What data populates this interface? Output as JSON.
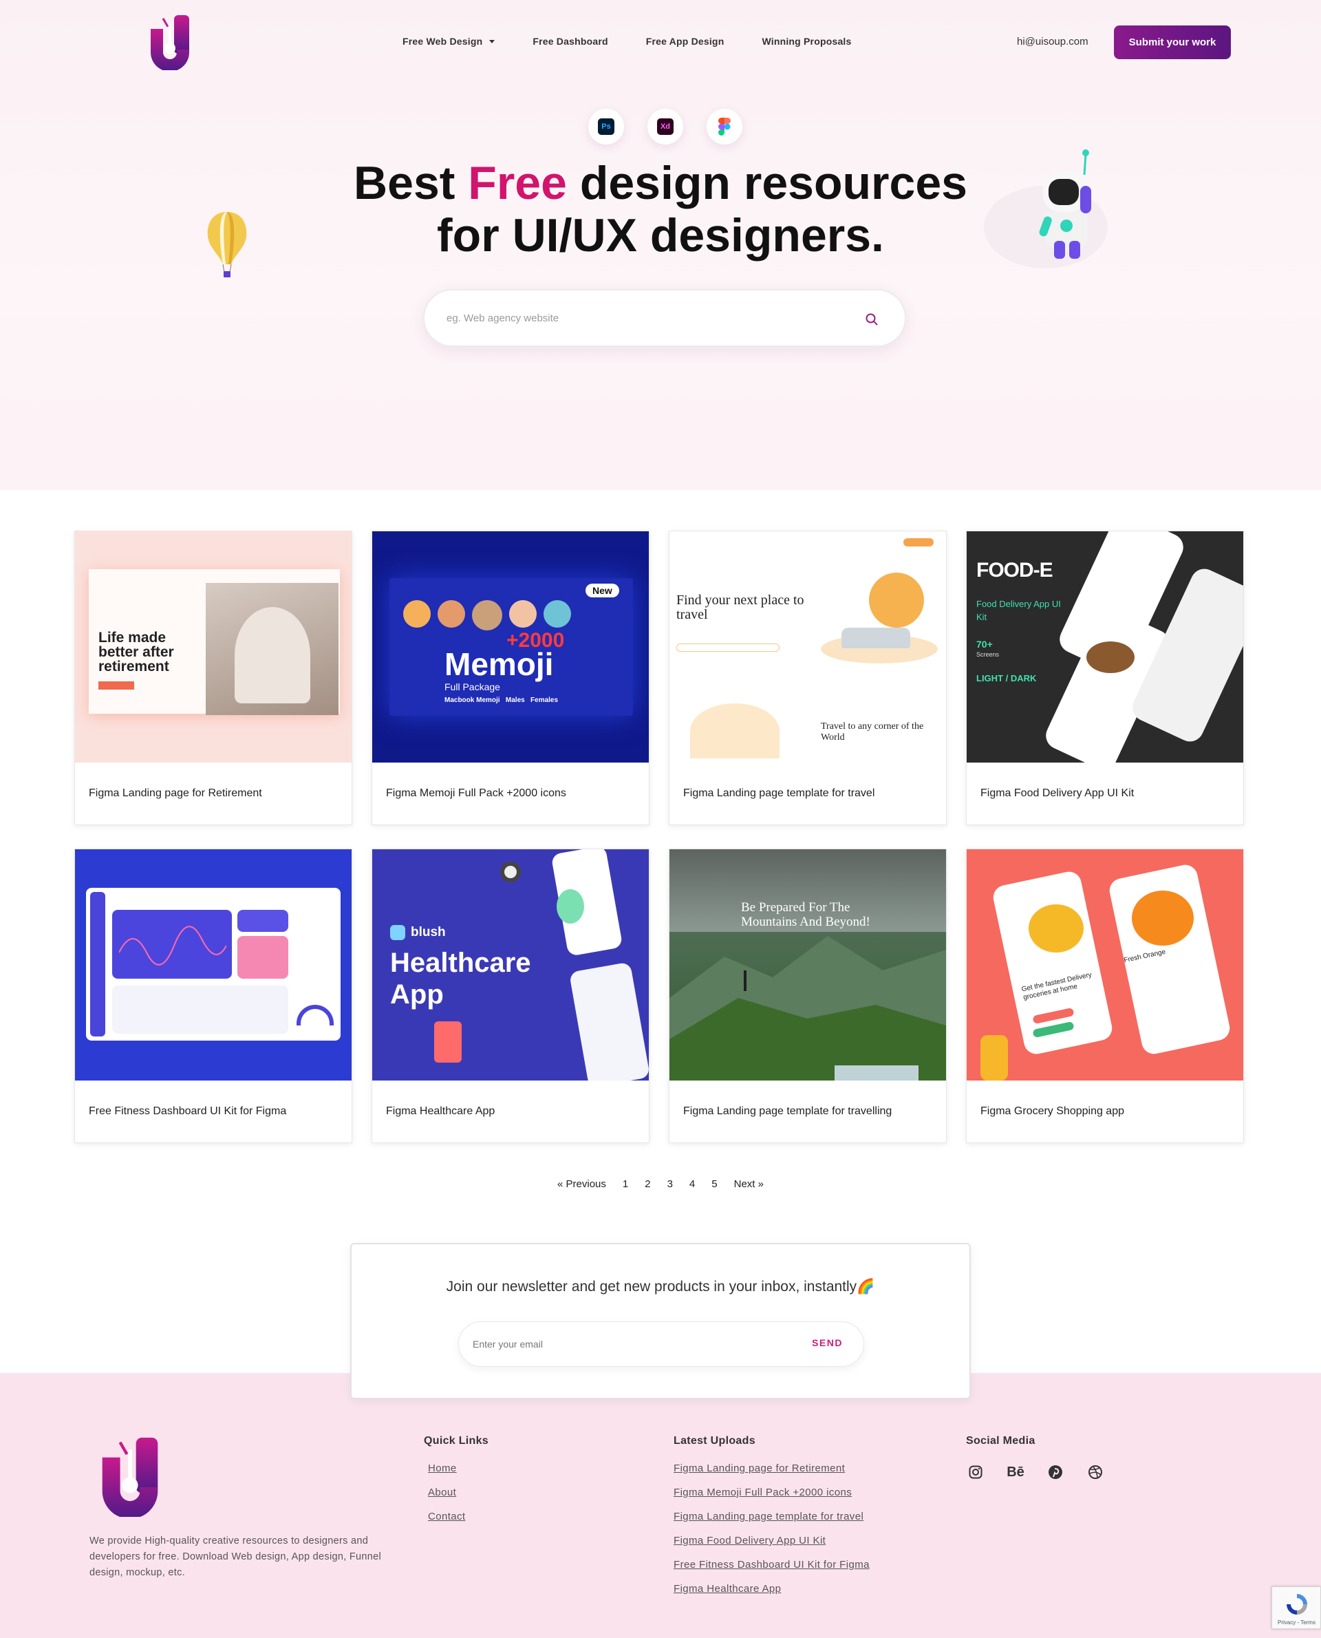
{
  "header": {
    "nav": [
      {
        "label": "Free Web Design",
        "dropdown": true
      },
      {
        "label": "Free Dashboard",
        "dropdown": false
      },
      {
        "label": "Free App Design",
        "dropdown": false
      },
      {
        "label": "Winning Proposals",
        "dropdown": false
      }
    ],
    "email": "hi@uisoup.com",
    "submit_label": "Submit your work"
  },
  "hero": {
    "tools": [
      "Ps",
      "Xd",
      "figma-icon"
    ],
    "headline_part1": "Best ",
    "headline_accent": "Free",
    "headline_part2": " design resources",
    "headline_line2": "for UI/UX designers.",
    "search_placeholder": "eg. Web agency website",
    "accent_color": "#d1146c"
  },
  "cards": [
    {
      "title": "Figma Landing page for Retirement",
      "thumb_headline": "Life made better after retirement"
    },
    {
      "title": "Figma Memoji Full Pack +2000 icons",
      "thumb_headline": "Memoji",
      "thumb_sub": "Full Package",
      "thumb_count": "+2000",
      "thumb_badge": "New",
      "thumb_tags": "Macbook Memoji   Males   Females"
    },
    {
      "title": "Figma Landing page template for travel",
      "thumb_headline": "Find your next place to travel",
      "thumb_sub": "Travel to any corner of the World"
    },
    {
      "title": "Figma Food Delivery App UI Kit",
      "thumb_headline": "FOOD-E",
      "thumb_sub": "Food Delivery App UI Kit",
      "thumb_count": "70+",
      "thumb_screens": "Screens",
      "thumb_modes": "LIGHT / DARK"
    },
    {
      "title": "Free Fitness Dashboard UI Kit for Figma"
    },
    {
      "title": "Figma Healthcare App",
      "thumb_brand": "blush",
      "thumb_headline": "Healthcare App"
    },
    {
      "title": "Figma Landing page template for travelling",
      "thumb_headline": "Be Prepared For The Mountains And Beyond!"
    },
    {
      "title": "Figma Grocery Shopping app",
      "thumb_headline": "Get the fastest Delivery groceries at home",
      "thumb_sub": "Fresh Orange"
    }
  ],
  "pagination": {
    "prev": "« Previous",
    "pages": [
      "1",
      "2",
      "3",
      "4",
      "5"
    ],
    "next": "Next »"
  },
  "newsletter": {
    "text": "Join our newsletter and get new products in your inbox, instantly🌈",
    "placeholder": "Enter your email",
    "send": "SEND"
  },
  "footer": {
    "description": "We provide High-quality creative resources to designers and developers for free. Download Web design, App design, Funnel design, mockup, etc.",
    "quick_links_title": "Quick Links",
    "quick_links": [
      "Home",
      "About",
      "Contact"
    ],
    "latest_title": "Latest Uploads",
    "latest": [
      "Figma Landing page for Retirement",
      "Figma Memoji Full Pack +2000 icons",
      "Figma Landing page template for travel",
      "Figma Food Delivery App UI Kit",
      "Free Fitness Dashboard UI Kit for Figma",
      "Figma Healthcare App"
    ],
    "social_title": "Social Media",
    "social": [
      "instagram-icon",
      "behance-icon",
      "pinterest-icon",
      "dribbble-icon"
    ],
    "behance_label": "Bē"
  },
  "recaptcha": {
    "text": "Privacy - Terms"
  }
}
